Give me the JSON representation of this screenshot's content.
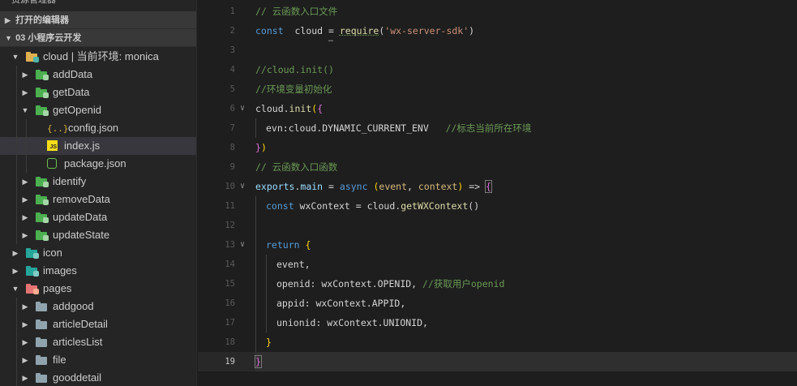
{
  "sidebar": {
    "pane_title": "资源管理器",
    "open_editors_label": "打开的编辑器",
    "project_label": "03 小程序云开发",
    "tree": [
      {
        "label": "cloud | 当前环境: monica",
        "depth": 0,
        "kind": "cloud-folder",
        "expanded": true
      },
      {
        "label": "addData",
        "depth": 1,
        "kind": "cloud-fn",
        "expanded": false
      },
      {
        "label": "getData",
        "depth": 1,
        "kind": "cloud-fn",
        "expanded": false
      },
      {
        "label": "getOpenid",
        "depth": 1,
        "kind": "cloud-fn",
        "expanded": true
      },
      {
        "label": "config.json",
        "depth": 2,
        "kind": "json"
      },
      {
        "label": "index.js",
        "depth": 2,
        "kind": "js",
        "selected": true
      },
      {
        "label": "package.json",
        "depth": 2,
        "kind": "npm"
      },
      {
        "label": "identify",
        "depth": 1,
        "kind": "cloud-fn",
        "expanded": false
      },
      {
        "label": "removeData",
        "depth": 1,
        "kind": "cloud-fn",
        "expanded": false
      },
      {
        "label": "updateData",
        "depth": 1,
        "kind": "cloud-fn",
        "expanded": false
      },
      {
        "label": "updateState",
        "depth": 1,
        "kind": "cloud-fn",
        "expanded": false
      },
      {
        "label": "icon",
        "depth": 0,
        "kind": "teal-folder",
        "expanded": false
      },
      {
        "label": "images",
        "depth": 0,
        "kind": "teal-folder",
        "expanded": false
      },
      {
        "label": "pages",
        "depth": 0,
        "kind": "red-folder",
        "expanded": true
      },
      {
        "label": "addgood",
        "depth": 1,
        "kind": "grey-folder",
        "expanded": false
      },
      {
        "label": "articleDetail",
        "depth": 1,
        "kind": "grey-folder",
        "expanded": false
      },
      {
        "label": "articlesList",
        "depth": 1,
        "kind": "grey-folder",
        "expanded": false
      },
      {
        "label": "file",
        "depth": 1,
        "kind": "grey-folder",
        "expanded": false
      },
      {
        "label": "gooddetail",
        "depth": 1,
        "kind": "grey-folder",
        "expanded": false
      }
    ]
  },
  "editor": {
    "active_line": 19,
    "lines": [
      {
        "n": "1",
        "fold": false,
        "indent": 0,
        "tokens": [
          [
            "c-comment",
            "// 云函数入口文件"
          ]
        ]
      },
      {
        "n": "2",
        "fold": false,
        "indent": 0,
        "tokens": [
          [
            "c-kw",
            "const"
          ],
          [
            "",
            "  cloud "
          ],
          [
            "",
            "= "
          ],
          [
            "c-fn underline",
            "require"
          ],
          [
            "",
            "("
          ],
          [
            "c-str",
            "'wx-server-sdk'"
          ],
          [
            "",
            ")"
          ]
        ]
      },
      {
        "n": "3",
        "fold": false,
        "indent": 0,
        "tokens": []
      },
      {
        "n": "4",
        "fold": false,
        "indent": 0,
        "tokens": [
          [
            "c-comment",
            "//cloud.init()"
          ]
        ]
      },
      {
        "n": "5",
        "fold": false,
        "indent": 0,
        "tokens": [
          [
            "c-comment",
            "//环境变量初始化"
          ]
        ]
      },
      {
        "n": "6",
        "fold": true,
        "indent": 0,
        "tokens": [
          [
            "",
            "cloud."
          ],
          [
            "c-fn",
            "init"
          ],
          [
            "c-brk",
            "("
          ],
          [
            "c-brk2",
            "{"
          ]
        ]
      },
      {
        "n": "7",
        "fold": false,
        "indent": 1,
        "tokens": [
          [
            "",
            "evn:cloud.DYNAMIC_CURRENT_ENV   "
          ],
          [
            "c-comment",
            "//标志当前所在环境"
          ]
        ]
      },
      {
        "n": "8",
        "fold": false,
        "indent": 0,
        "tokens": [
          [
            "c-brk2",
            "}"
          ],
          [
            "c-brk",
            ")"
          ]
        ]
      },
      {
        "n": "9",
        "fold": false,
        "indent": 0,
        "tokens": [
          [
            "c-comment",
            "// 云函数入口函数"
          ]
        ]
      },
      {
        "n": "10",
        "fold": true,
        "indent": 0,
        "tokens": [
          [
            "c-prop",
            "exports"
          ],
          [
            "",
            "."
          ],
          [
            "c-prop",
            "main"
          ],
          [
            "",
            " = "
          ],
          [
            "c-kw",
            "async"
          ],
          [
            "",
            " "
          ],
          [
            "c-brk",
            "("
          ],
          [
            "c-orange",
            "event"
          ],
          [
            "",
            ", "
          ],
          [
            "c-orange",
            "context"
          ],
          [
            "c-brk",
            ")"
          ],
          [
            "",
            " => "
          ],
          [
            "c-brk2 bracket-box",
            "{"
          ]
        ]
      },
      {
        "n": "11",
        "fold": false,
        "indent": 1,
        "tokens": [
          [
            "c-kw",
            "const"
          ],
          [
            "",
            " wxContext = cloud."
          ],
          [
            "c-fn",
            "getWXContext"
          ],
          [
            "",
            "()"
          ]
        ]
      },
      {
        "n": "12",
        "fold": false,
        "indent": 1,
        "tokens": []
      },
      {
        "n": "13",
        "fold": true,
        "indent": 1,
        "tokens": [
          [
            "c-kw",
            "return"
          ],
          [
            "",
            " "
          ],
          [
            "c-brk",
            "{"
          ]
        ]
      },
      {
        "n": "14",
        "fold": false,
        "indent": 2,
        "tokens": [
          [
            "",
            "event,"
          ]
        ]
      },
      {
        "n": "15",
        "fold": false,
        "indent": 2,
        "tokens": [
          [
            "",
            "openid: wxContext.OPENID, "
          ],
          [
            "c-comment",
            "//获取用户openid"
          ]
        ]
      },
      {
        "n": "16",
        "fold": false,
        "indent": 2,
        "tokens": [
          [
            "",
            "appid: wxContext.APPID,"
          ]
        ]
      },
      {
        "n": "17",
        "fold": false,
        "indent": 2,
        "tokens": [
          [
            "",
            "unionid: wxContext.UNIONID,"
          ]
        ]
      },
      {
        "n": "18",
        "fold": false,
        "indent": 1,
        "tokens": [
          [
            "c-brk",
            "}"
          ]
        ]
      },
      {
        "n": "19",
        "fold": false,
        "indent": 0,
        "tokens": [
          [
            "c-brk2 bracket-box",
            "}"
          ]
        ]
      }
    ],
    "ellipsis": "…"
  },
  "colors": {
    "cloud_fn_icon": "#4caf50",
    "teal_folder": "#26a69a",
    "red_folder": "#e57373",
    "grey_folder": "#90a4ae",
    "json_icon": "#d6b13a",
    "js_icon": "#f5de19",
    "npm_icon": "#6fbf4b"
  }
}
